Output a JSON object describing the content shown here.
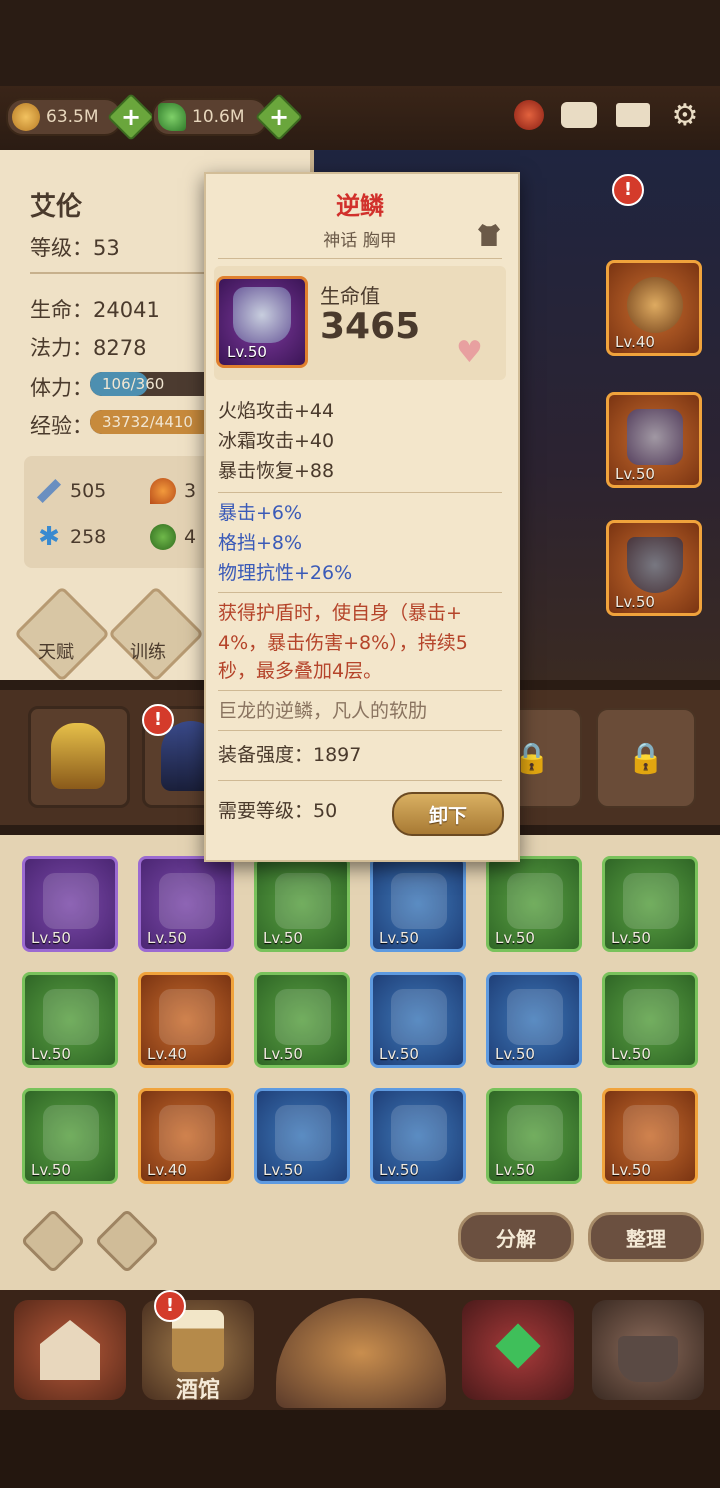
{
  "resources": {
    "gold": "63.5M",
    "gems": "10.6M"
  },
  "hero": {
    "name": "艾伦",
    "level_label": "等级：53",
    "hp_label": "生命：24041",
    "mp_label": "法力：8278",
    "stamina_label": "体力：",
    "stamina_value": "106/360",
    "stamina_fraction": 0.29,
    "exp_label": "经验：",
    "exp_value": "33732/4410",
    "exp_fraction": 0.76,
    "attrs": [
      "505",
      "3",
      "258",
      "4"
    ]
  },
  "tabs": {
    "talent": "天赋",
    "train": "训练"
  },
  "tooltip": {
    "name": "逆鳞",
    "subtitle": "神话 胸甲",
    "item_level": "Lv.50",
    "stat_label": "生命值",
    "stat_value": "3465",
    "bonus_stats": [
      "火焰攻击+44",
      "冰霜攻击+40",
      "暴击恢复+88"
    ],
    "special_stats": [
      "暴击+6%",
      "格挡+8%",
      "物理抗性+26%"
    ],
    "effect_lines": [
      "获得护盾时，使自身（暴击+",
      "4%，暴击伤害+8%），持续5",
      "秒，最多叠加4层。"
    ],
    "flavor": "巨龙的逆鳞，凡人的软肋",
    "power": "装备强度：1897",
    "req_level": "需要等级：50",
    "unequip": "卸下"
  },
  "inventory": [
    {
      "lv": "Lv.50",
      "rarity": "purple"
    },
    {
      "lv": "Lv.50",
      "rarity": "purple"
    },
    {
      "lv": "Lv.50",
      "rarity": "green"
    },
    {
      "lv": "Lv.50",
      "rarity": "blue"
    },
    {
      "lv": "Lv.50",
      "rarity": "green"
    },
    {
      "lv": "Lv.50",
      "rarity": "green"
    },
    {
      "lv": "Lv.50",
      "rarity": "green"
    },
    {
      "lv": "Lv.40",
      "rarity": "orange"
    },
    {
      "lv": "Lv.50",
      "rarity": "green"
    },
    {
      "lv": "Lv.50",
      "rarity": "blue"
    },
    {
      "lv": "Lv.50",
      "rarity": "blue"
    },
    {
      "lv": "Lv.50",
      "rarity": "green"
    },
    {
      "lv": "Lv.50",
      "rarity": "green"
    },
    {
      "lv": "Lv.40",
      "rarity": "orange"
    },
    {
      "lv": "Lv.50",
      "rarity": "blue"
    },
    {
      "lv": "Lv.50",
      "rarity": "blue"
    },
    {
      "lv": "Lv.50",
      "rarity": "green"
    },
    {
      "lv": "Lv.50",
      "rarity": "orange"
    }
  ],
  "equipped": [
    {
      "lv": "Lv.40"
    },
    {
      "lv": "Lv.50"
    },
    {
      "lv": "Lv.50"
    }
  ],
  "actions": {
    "decompose": "分解",
    "sort": "整理"
  },
  "nav": {
    "tavern": "酒馆"
  },
  "colors": {
    "title_red": "#d1302b",
    "special_blue": "#3a5ab8",
    "effect_red": "#b5442a",
    "parchment": "#f3e6cb"
  }
}
